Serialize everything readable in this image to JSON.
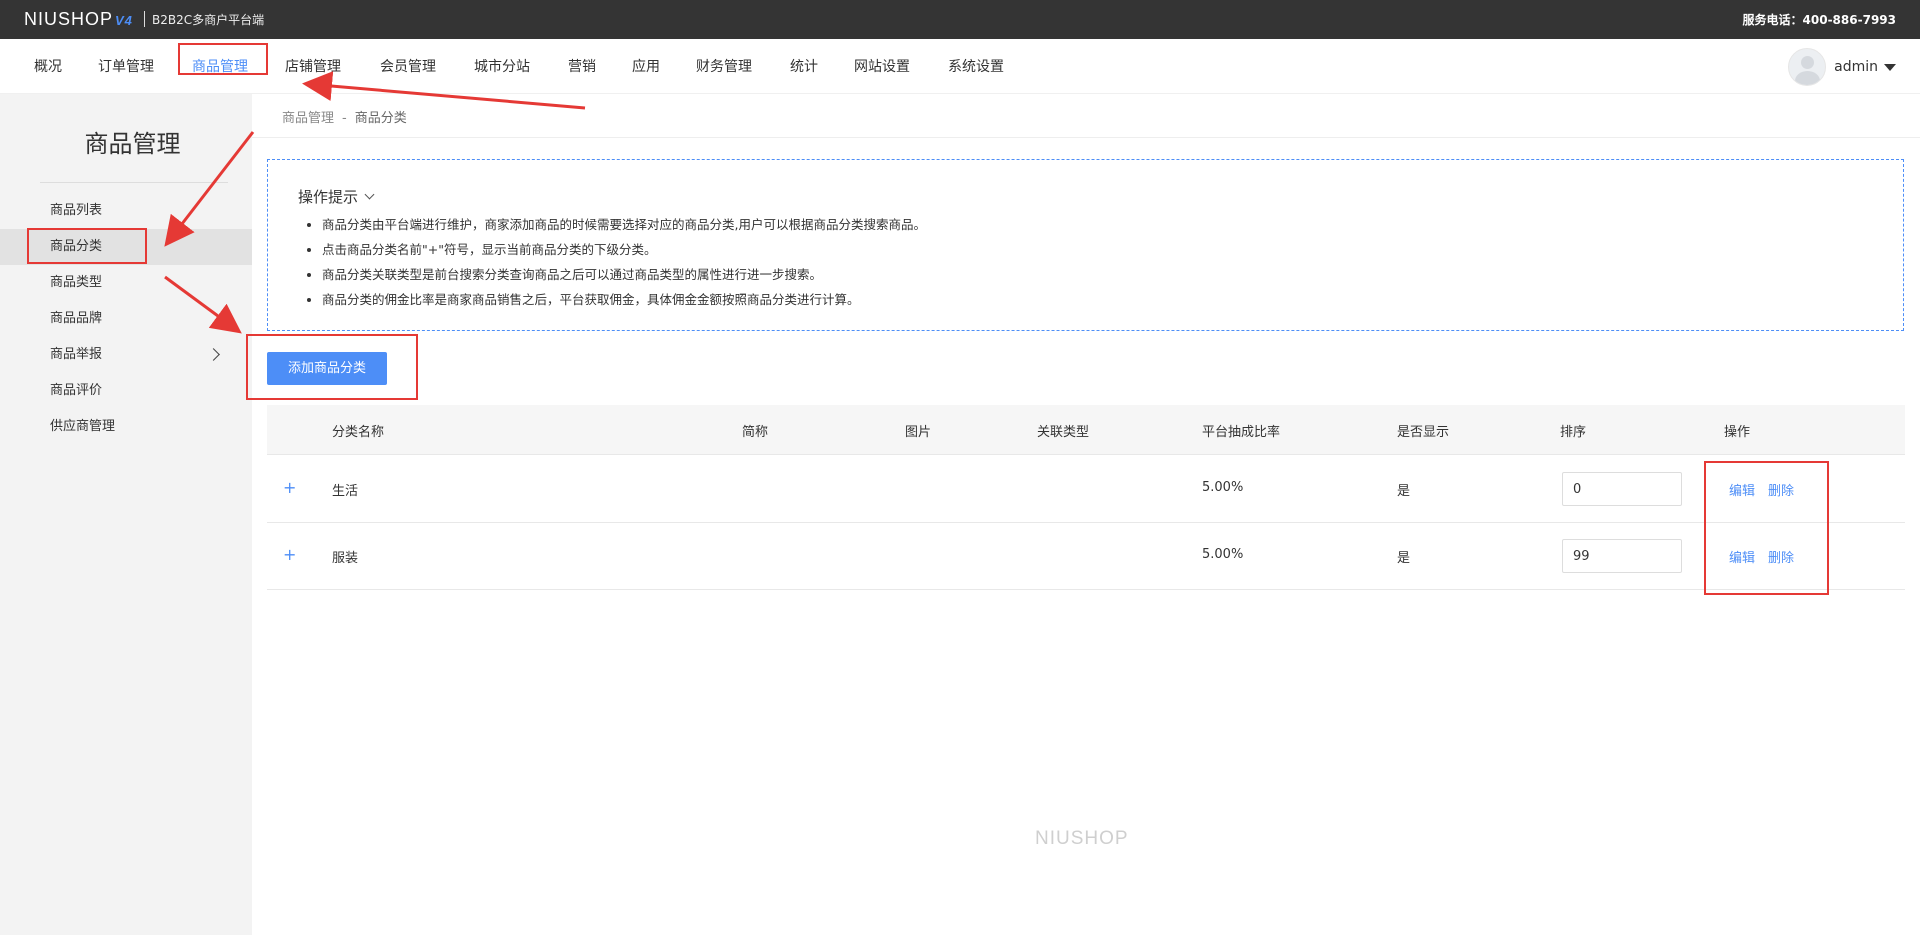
{
  "topbar": {
    "logo": "NIUSHOP",
    "logo_version": "V4",
    "platform": "B2B2C多商户平台端",
    "hotline": "服务电话：400-886-7993"
  },
  "nav": {
    "items": [
      {
        "label": "概况"
      },
      {
        "label": "订单管理"
      },
      {
        "label": "商品管理",
        "active": true
      },
      {
        "label": "店铺管理"
      },
      {
        "label": "会员管理"
      },
      {
        "label": "城市分站"
      },
      {
        "label": "营销"
      },
      {
        "label": "应用"
      },
      {
        "label": "财务管理"
      },
      {
        "label": "统计"
      },
      {
        "label": "网站设置"
      },
      {
        "label": "系统设置"
      }
    ],
    "user": "admin"
  },
  "sidebar": {
    "title": "商品管理",
    "items": [
      {
        "label": "商品列表"
      },
      {
        "label": "商品分类",
        "active": true
      },
      {
        "label": "商品类型"
      },
      {
        "label": "商品品牌"
      },
      {
        "label": "商品举报",
        "has_submenu": true
      },
      {
        "label": "商品评价"
      },
      {
        "label": "供应商管理"
      }
    ]
  },
  "breadcrumb": {
    "parent": "商品管理",
    "separator": "-",
    "current": "商品分类"
  },
  "tips": {
    "title": "操作提示",
    "items": [
      "商品分类由平台端进行维护，商家添加商品的时候需要选择对应的商品分类,用户可以根据商品分类搜索商品。",
      "点击商品分类名前\"+\"符号，显示当前商品分类的下级分类。",
      "商品分类关联类型是前台搜索分类查询商品之后可以通过商品类型的属性进行进一步搜索。",
      "商品分类的佣金比率是商家商品销售之后，平台获取佣金，具体佣金金额按照商品分类进行计算。"
    ]
  },
  "add_button": "添加商品分类",
  "table": {
    "columns": [
      "分类名称",
      "简称",
      "图片",
      "关联类型",
      "平台抽成比率",
      "是否显示",
      "排序",
      "操作"
    ],
    "rows": [
      {
        "expand": "+",
        "name": "生活",
        "short": "",
        "image": "",
        "type": "",
        "rate": "5.00%",
        "visible": "是",
        "sort": "0",
        "edit": "编辑",
        "delete": "删除"
      },
      {
        "expand": "+",
        "name": "服装",
        "short": "",
        "image": "",
        "type": "",
        "rate": "5.00%",
        "visible": "是",
        "sort": "99",
        "edit": "编辑",
        "delete": "删除"
      }
    ]
  },
  "footer": {
    "logo": "NIUSHOP"
  },
  "colors": {
    "accent": "#4d8ef7",
    "topbar": "#343434",
    "annotation": "#e53935"
  }
}
